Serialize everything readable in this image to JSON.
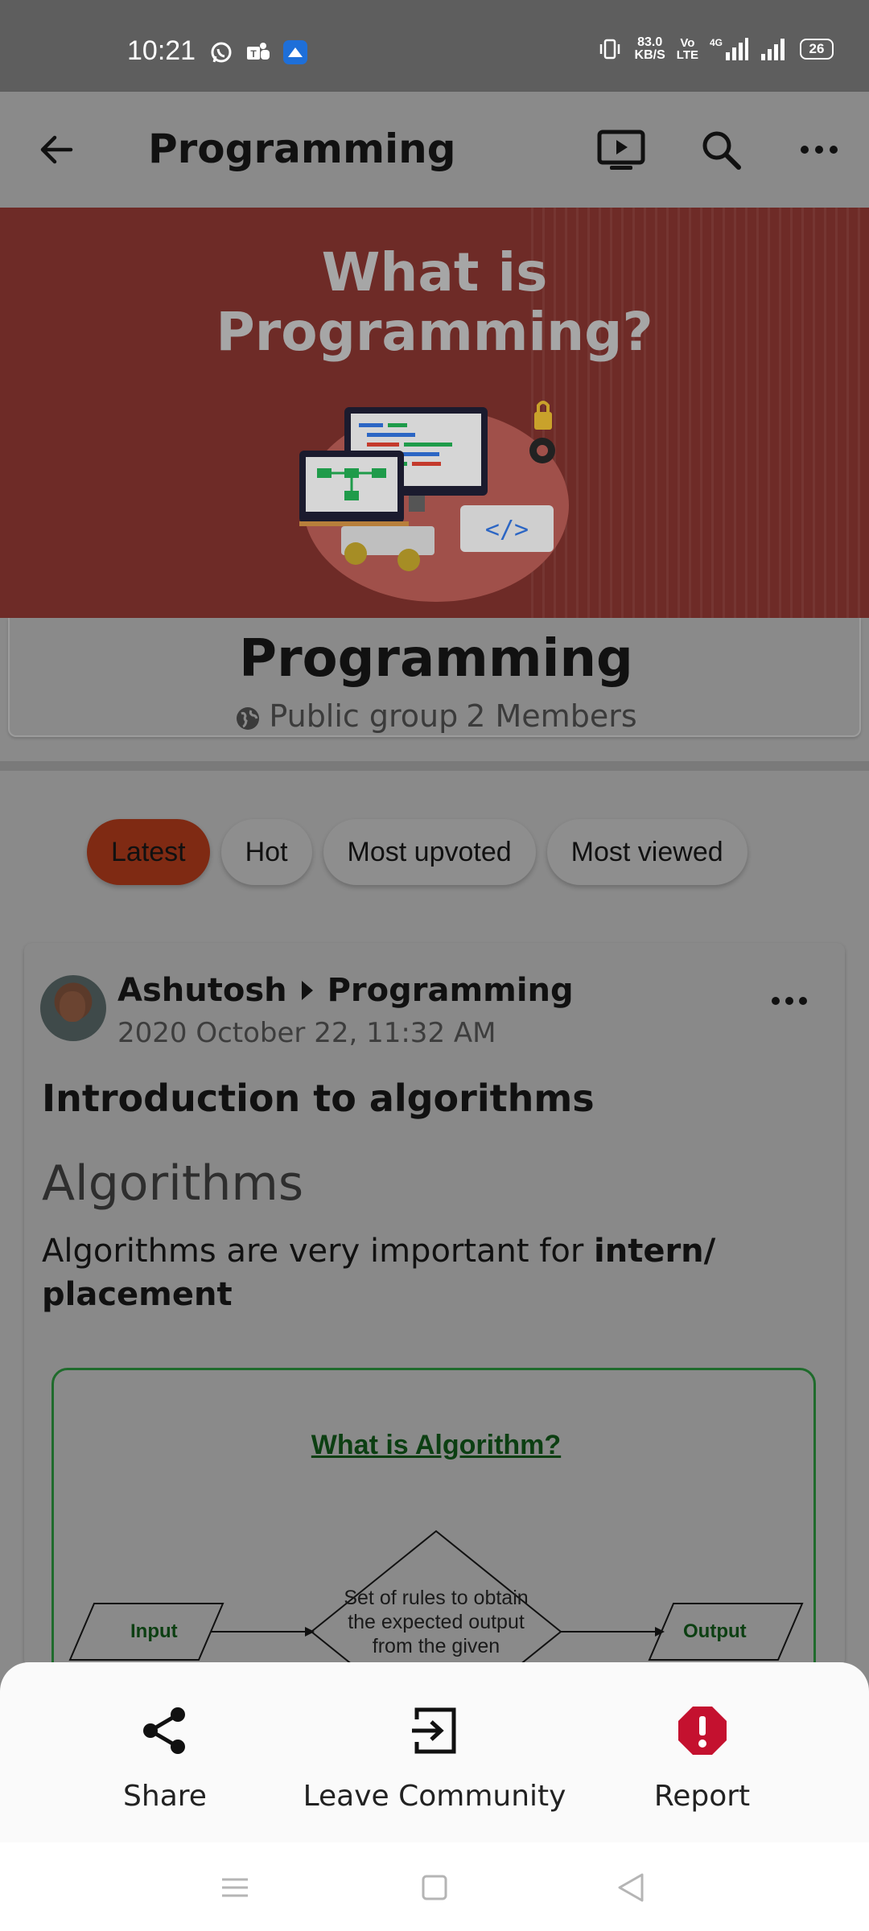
{
  "status_bar": {
    "time": "10:21",
    "net_speed_value": "83.0",
    "net_speed_unit": "KB/S",
    "volte_top": "Vo",
    "volte_bottom": "LTE",
    "network": "4G",
    "battery": "26",
    "notification_icons": [
      "whatsapp-icon",
      "teams-icon",
      "cloud-app-icon"
    ]
  },
  "app_bar": {
    "title": "Programming",
    "icons": [
      "back-arrow-icon",
      "cast-icon",
      "search-icon",
      "more-options-icon"
    ]
  },
  "banner": {
    "headline_line1": "What is",
    "headline_line2": "Programming?"
  },
  "group": {
    "name": "Programming",
    "privacy": "Public group",
    "members": "2 Members"
  },
  "filters": {
    "active": "Latest",
    "items": [
      "Latest",
      "Hot",
      "Most upvoted",
      "Most viewed"
    ]
  },
  "post": {
    "author": "Ashutosh",
    "community": "Programming",
    "date": "2020 October 22, 11:32 AM",
    "title": "Introduction to algorithms",
    "heading": "Algorithms",
    "body_plain": "Algorithms are very important for ",
    "body_bold": "intern/ placement",
    "figure": {
      "title": "What is Algorithm?",
      "input_label": "Input",
      "output_label": "Output",
      "rule_text": "Set of rules to obtain the expected output from the given"
    }
  },
  "bottom_sheet": {
    "actions": [
      {
        "label": "Share",
        "icon": "share-icon"
      },
      {
        "label": "Leave Community",
        "icon": "exit-icon"
      },
      {
        "label": "Report",
        "icon": "report-icon",
        "color": "#c4112f"
      }
    ]
  },
  "nav_bar": {
    "buttons": [
      "recent-apps-icon",
      "home-icon",
      "back-icon"
    ]
  },
  "colors": {
    "scrim": "#8a8a8a",
    "banner_bg": "#6e2b27",
    "active_chip": "#7f2a13",
    "report_red": "#c4112f"
  }
}
